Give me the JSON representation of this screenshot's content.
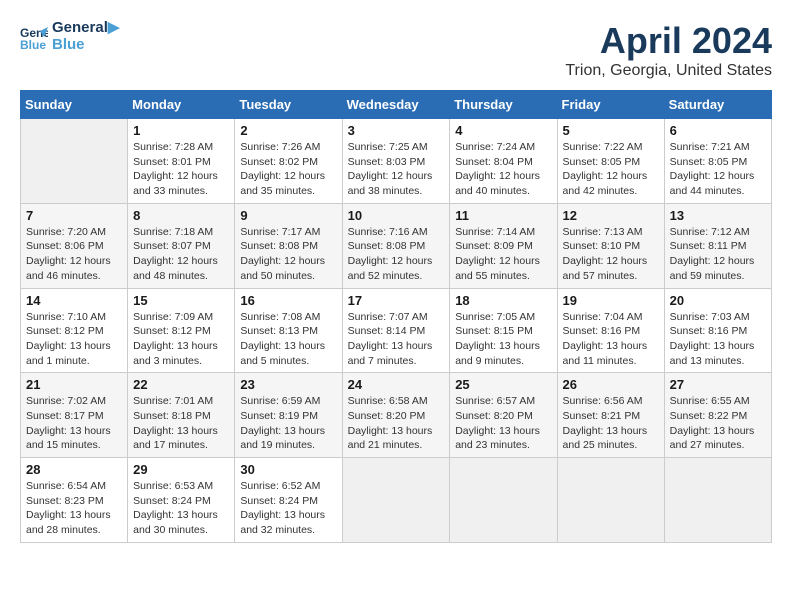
{
  "header": {
    "logo_line1": "General",
    "logo_line2": "Blue",
    "month_title": "April 2024",
    "location": "Trion, Georgia, United States"
  },
  "days_of_week": [
    "Sunday",
    "Monday",
    "Tuesday",
    "Wednesday",
    "Thursday",
    "Friday",
    "Saturday"
  ],
  "weeks": [
    [
      {
        "day": "",
        "info": ""
      },
      {
        "day": "1",
        "info": "Sunrise: 7:28 AM\nSunset: 8:01 PM\nDaylight: 12 hours\nand 33 minutes."
      },
      {
        "day": "2",
        "info": "Sunrise: 7:26 AM\nSunset: 8:02 PM\nDaylight: 12 hours\nand 35 minutes."
      },
      {
        "day": "3",
        "info": "Sunrise: 7:25 AM\nSunset: 8:03 PM\nDaylight: 12 hours\nand 38 minutes."
      },
      {
        "day": "4",
        "info": "Sunrise: 7:24 AM\nSunset: 8:04 PM\nDaylight: 12 hours\nand 40 minutes."
      },
      {
        "day": "5",
        "info": "Sunrise: 7:22 AM\nSunset: 8:05 PM\nDaylight: 12 hours\nand 42 minutes."
      },
      {
        "day": "6",
        "info": "Sunrise: 7:21 AM\nSunset: 8:05 PM\nDaylight: 12 hours\nand 44 minutes."
      }
    ],
    [
      {
        "day": "7",
        "info": "Sunrise: 7:20 AM\nSunset: 8:06 PM\nDaylight: 12 hours\nand 46 minutes."
      },
      {
        "day": "8",
        "info": "Sunrise: 7:18 AM\nSunset: 8:07 PM\nDaylight: 12 hours\nand 48 minutes."
      },
      {
        "day": "9",
        "info": "Sunrise: 7:17 AM\nSunset: 8:08 PM\nDaylight: 12 hours\nand 50 minutes."
      },
      {
        "day": "10",
        "info": "Sunrise: 7:16 AM\nSunset: 8:08 PM\nDaylight: 12 hours\nand 52 minutes."
      },
      {
        "day": "11",
        "info": "Sunrise: 7:14 AM\nSunset: 8:09 PM\nDaylight: 12 hours\nand 55 minutes."
      },
      {
        "day": "12",
        "info": "Sunrise: 7:13 AM\nSunset: 8:10 PM\nDaylight: 12 hours\nand 57 minutes."
      },
      {
        "day": "13",
        "info": "Sunrise: 7:12 AM\nSunset: 8:11 PM\nDaylight: 12 hours\nand 59 minutes."
      }
    ],
    [
      {
        "day": "14",
        "info": "Sunrise: 7:10 AM\nSunset: 8:12 PM\nDaylight: 13 hours\nand 1 minute."
      },
      {
        "day": "15",
        "info": "Sunrise: 7:09 AM\nSunset: 8:12 PM\nDaylight: 13 hours\nand 3 minutes."
      },
      {
        "day": "16",
        "info": "Sunrise: 7:08 AM\nSunset: 8:13 PM\nDaylight: 13 hours\nand 5 minutes."
      },
      {
        "day": "17",
        "info": "Sunrise: 7:07 AM\nSunset: 8:14 PM\nDaylight: 13 hours\nand 7 minutes."
      },
      {
        "day": "18",
        "info": "Sunrise: 7:05 AM\nSunset: 8:15 PM\nDaylight: 13 hours\nand 9 minutes."
      },
      {
        "day": "19",
        "info": "Sunrise: 7:04 AM\nSunset: 8:16 PM\nDaylight: 13 hours\nand 11 minutes."
      },
      {
        "day": "20",
        "info": "Sunrise: 7:03 AM\nSunset: 8:16 PM\nDaylight: 13 hours\nand 13 minutes."
      }
    ],
    [
      {
        "day": "21",
        "info": "Sunrise: 7:02 AM\nSunset: 8:17 PM\nDaylight: 13 hours\nand 15 minutes."
      },
      {
        "day": "22",
        "info": "Sunrise: 7:01 AM\nSunset: 8:18 PM\nDaylight: 13 hours\nand 17 minutes."
      },
      {
        "day": "23",
        "info": "Sunrise: 6:59 AM\nSunset: 8:19 PM\nDaylight: 13 hours\nand 19 minutes."
      },
      {
        "day": "24",
        "info": "Sunrise: 6:58 AM\nSunset: 8:20 PM\nDaylight: 13 hours\nand 21 minutes."
      },
      {
        "day": "25",
        "info": "Sunrise: 6:57 AM\nSunset: 8:20 PM\nDaylight: 13 hours\nand 23 minutes."
      },
      {
        "day": "26",
        "info": "Sunrise: 6:56 AM\nSunset: 8:21 PM\nDaylight: 13 hours\nand 25 minutes."
      },
      {
        "day": "27",
        "info": "Sunrise: 6:55 AM\nSunset: 8:22 PM\nDaylight: 13 hours\nand 27 minutes."
      }
    ],
    [
      {
        "day": "28",
        "info": "Sunrise: 6:54 AM\nSunset: 8:23 PM\nDaylight: 13 hours\nand 28 minutes."
      },
      {
        "day": "29",
        "info": "Sunrise: 6:53 AM\nSunset: 8:24 PM\nDaylight: 13 hours\nand 30 minutes."
      },
      {
        "day": "30",
        "info": "Sunrise: 6:52 AM\nSunset: 8:24 PM\nDaylight: 13 hours\nand 32 minutes."
      },
      {
        "day": "",
        "info": ""
      },
      {
        "day": "",
        "info": ""
      },
      {
        "day": "",
        "info": ""
      },
      {
        "day": "",
        "info": ""
      }
    ]
  ]
}
